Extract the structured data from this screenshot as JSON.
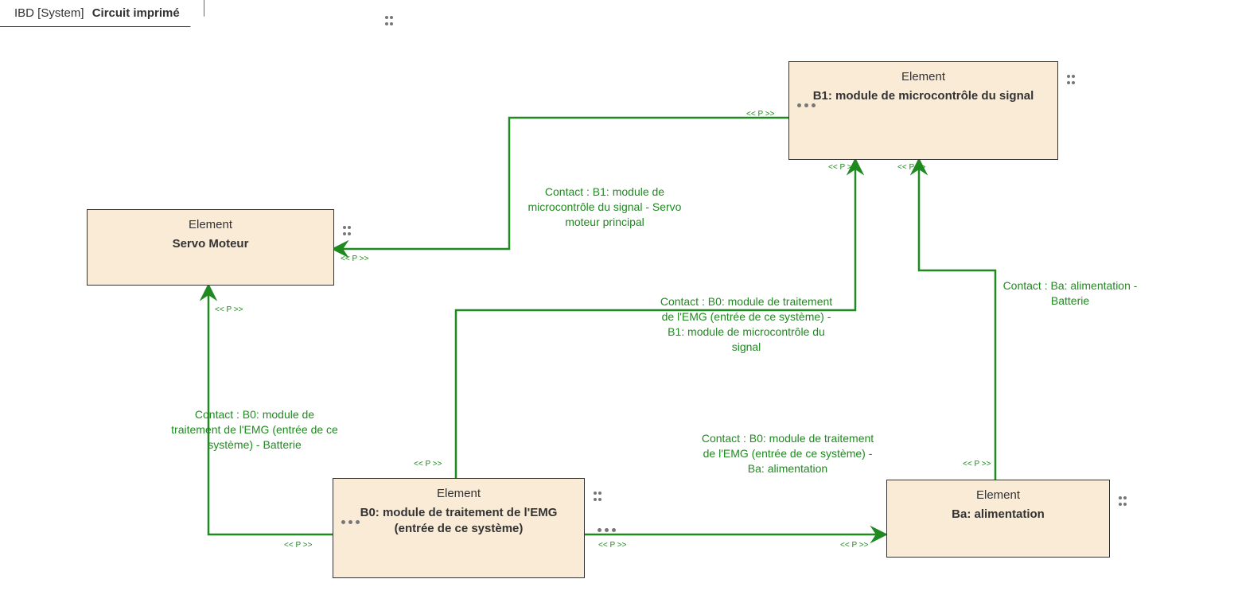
{
  "diagram": {
    "prefix": "IBD [System]",
    "name": "Circuit imprimé"
  },
  "elements": {
    "servo": {
      "stereotype": "Element",
      "name": "Servo Moteur"
    },
    "b1": {
      "stereotype": "Element",
      "name": "B1: module de microcontrôle du signal"
    },
    "b0": {
      "stereotype": "Element",
      "name": "B0: module de traitement de l'EMG (entrée de ce système)"
    },
    "ba": {
      "stereotype": "Element",
      "name": "Ba: alimentation"
    }
  },
  "connections": {
    "b1_servo": "Contact : B1: module de microcontrôle du signal - Servo moteur principal",
    "b0_b1": "Contact : B0: module de traitement de l'EMG (entrée de ce système) - B1: module de microcontrôle du signal",
    "b0_batt": "Contact : B0: module de traitement de l'EMG (entrée de ce système) - Batterie",
    "b0_ba": "Contact : B0: module de traitement de l'EMG (entrée de ce système) - Ba: alimentation",
    "ba_batt": "Contact : Ba: alimentation - Batterie"
  },
  "port_label": "<< P >>",
  "colors": {
    "connector": "#1f8a1f",
    "element_fill": "#FAEBD7"
  },
  "chart_data": {
    "type": "ibd-block-diagram",
    "title": "IBD [System] Circuit imprimé",
    "blocks": [
      {
        "id": "servo",
        "stereotype": "Element",
        "label": "Servo Moteur"
      },
      {
        "id": "b1",
        "stereotype": "Element",
        "label": "B1: module de microcontrôle du signal"
      },
      {
        "id": "b0",
        "stereotype": "Element",
        "label": "B0: module de traitement de l'EMG (entrée de ce système)"
      },
      {
        "id": "ba",
        "stereotype": "Element",
        "label": "Ba: alimentation"
      }
    ],
    "connectors": [
      {
        "from": "b1",
        "to": "servo",
        "label": "Contact : B1: module de microcontrôle du signal - Servo moteur principal",
        "directed": true
      },
      {
        "from": "b0",
        "to": "b1",
        "label": "Contact : B0: module de traitement de l'EMG (entrée de ce système) - B1: module de microcontrôle du signal",
        "directed": true
      },
      {
        "from": "b0",
        "to": "servo",
        "label": "Contact : B0: module de traitement de l'EMG (entrée de ce système) - Batterie",
        "directed": true
      },
      {
        "from": "b0",
        "to": "ba",
        "label": "Contact : B0: module de traitement de l'EMG (entrée de ce système) - Ba: alimentation",
        "directed": true
      },
      {
        "from": "ba",
        "to": "b1",
        "label": "Contact : Ba: alimentation - Batterie",
        "directed": true
      }
    ]
  }
}
